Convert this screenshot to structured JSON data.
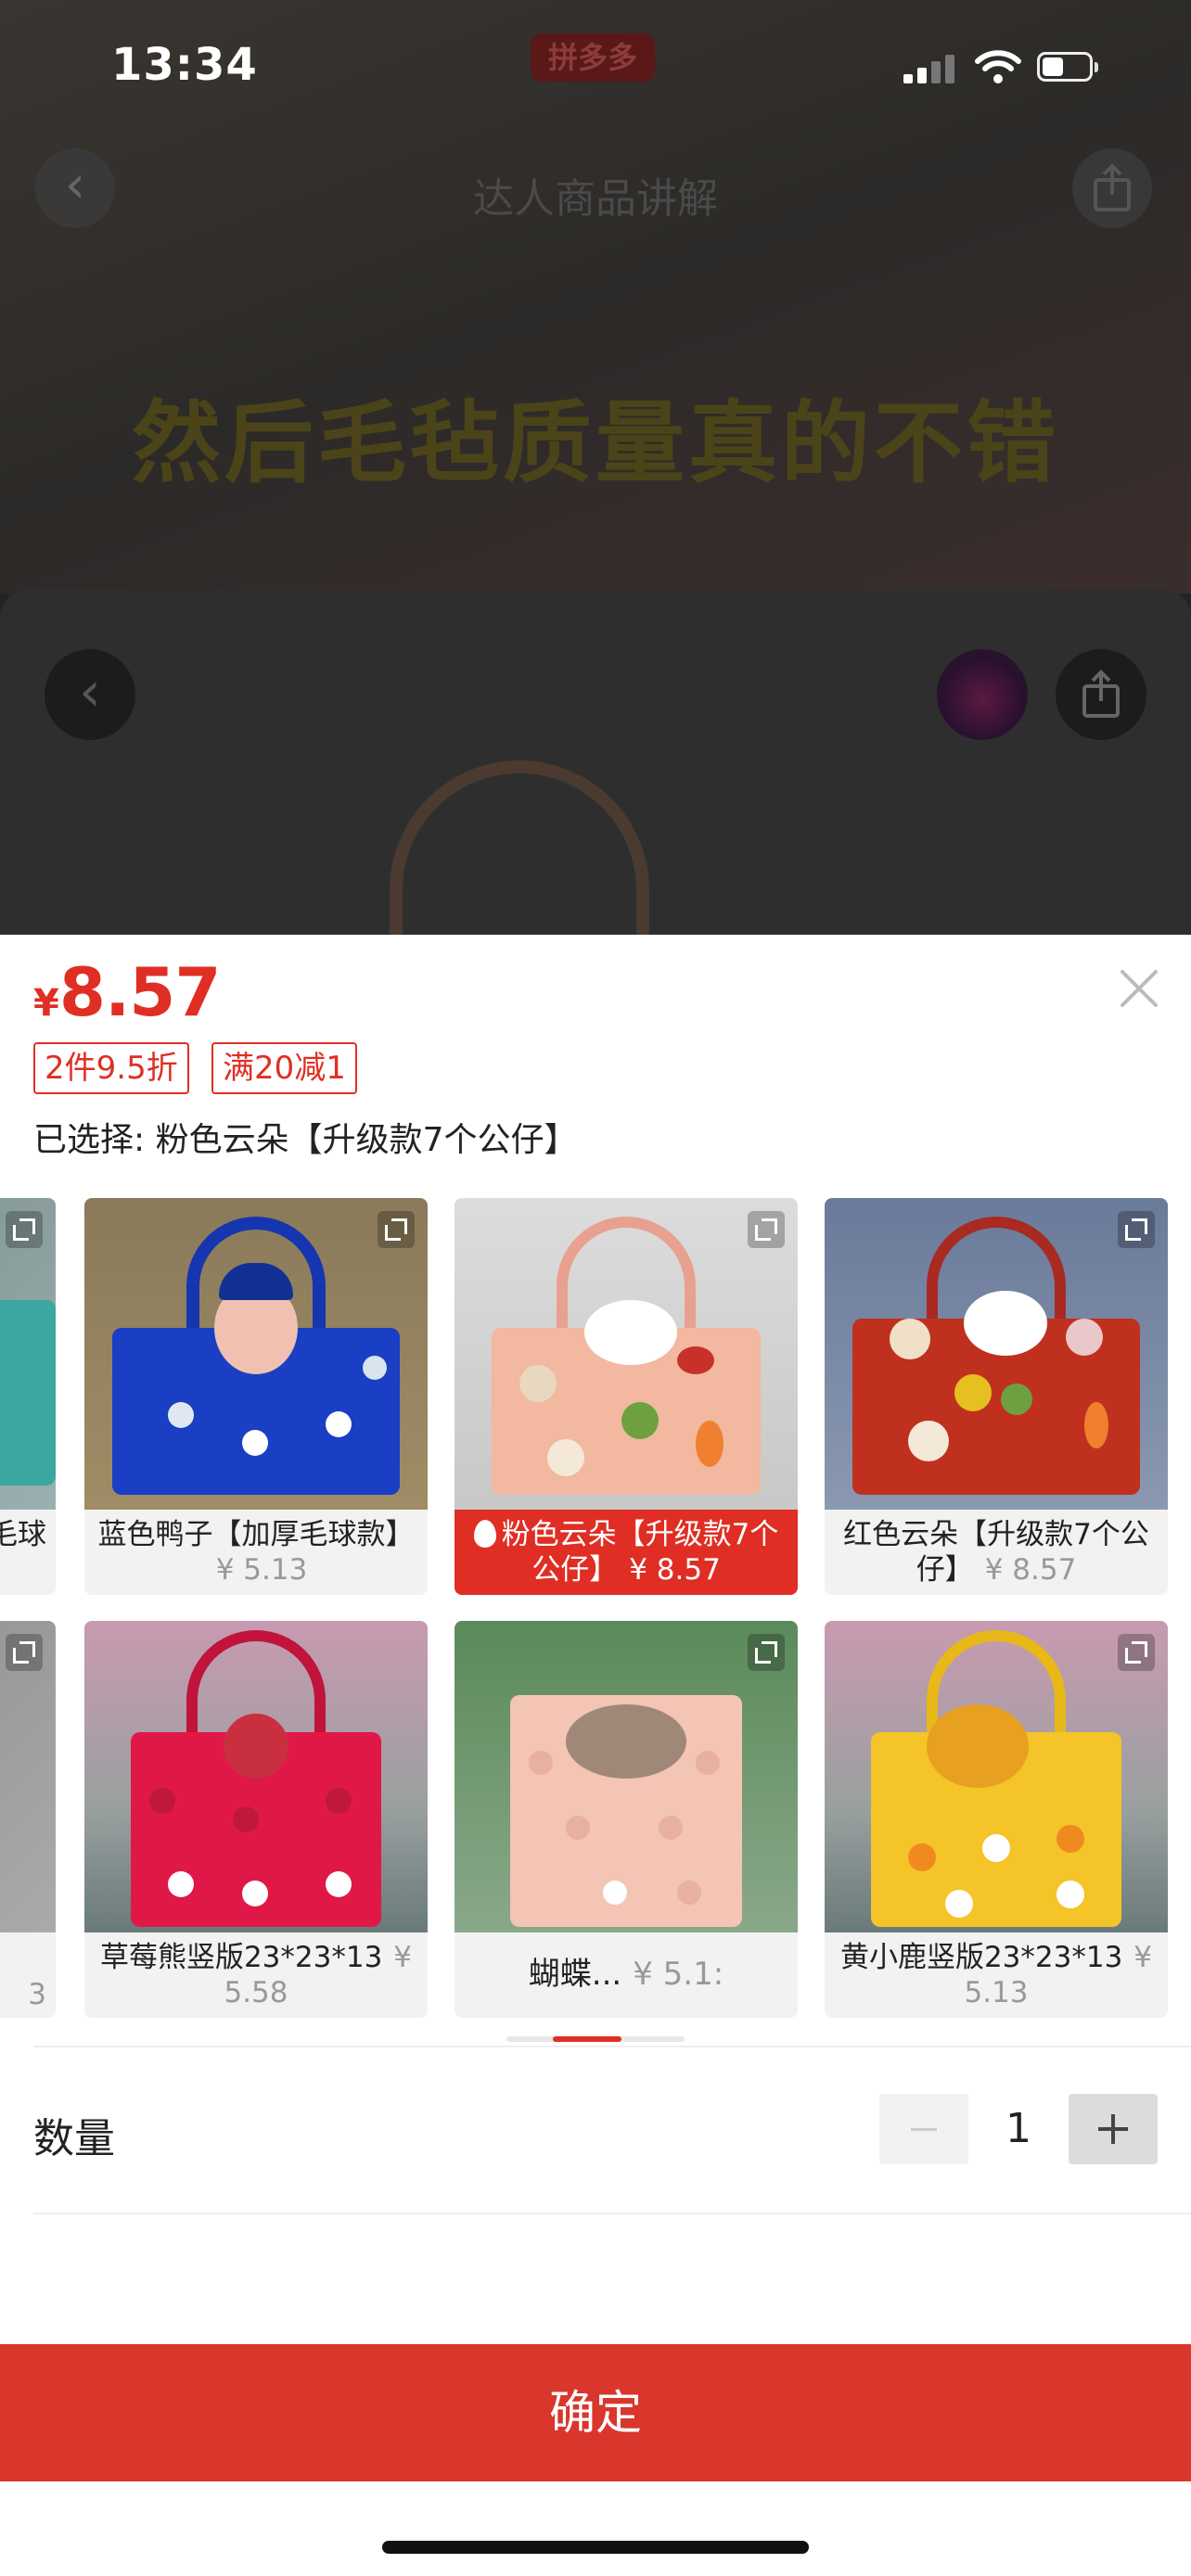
{
  "status_bar": {
    "time": "13:34",
    "app_badge": "拼多多"
  },
  "background_page": {
    "nav_title": "达人商品讲解",
    "video_caption": "然后毛毡质量真的不错"
  },
  "sheet": {
    "price_symbol": "¥",
    "price": "8.57",
    "tags": [
      "2件9.5折",
      "满20减1"
    ],
    "selected_label": "已选择: 粉色云朵【升级款7个公仔】",
    "variants_row1": [
      {
        "partial_text": "毛球"
      },
      {
        "name": "蓝色鸭子【加厚毛球款】",
        "price": "¥ 5.13",
        "selected": false
      },
      {
        "name": "粉色云朵【升级款7个公仔】",
        "price": "¥ 8.57",
        "selected": true
      },
      {
        "name": "红色云朵【升级款7个公仔】",
        "price": "¥ 8.57",
        "selected": false
      }
    ],
    "variants_row2": [
      {
        "partial_text": "3"
      },
      {
        "name": "草莓熊竖版23*23*13",
        "price": "¥ 5.58",
        "selected": false
      },
      {
        "name": "蝴蝶...",
        "price": "¥ 5.1:",
        "selected": false
      },
      {
        "name": "黄小鹿竖版23*23*13",
        "price": "¥ 5.13",
        "selected": false
      }
    ],
    "quantity_label": "数量",
    "quantity": "1",
    "confirm_label": "确定"
  },
  "colors": {
    "accent": "#e02e24",
    "confirm_button": "#d9362c"
  },
  "icons": [
    "back-icon",
    "share-icon",
    "close-icon",
    "expand-icon",
    "flame-icon",
    "minus-icon",
    "plus-icon"
  ]
}
